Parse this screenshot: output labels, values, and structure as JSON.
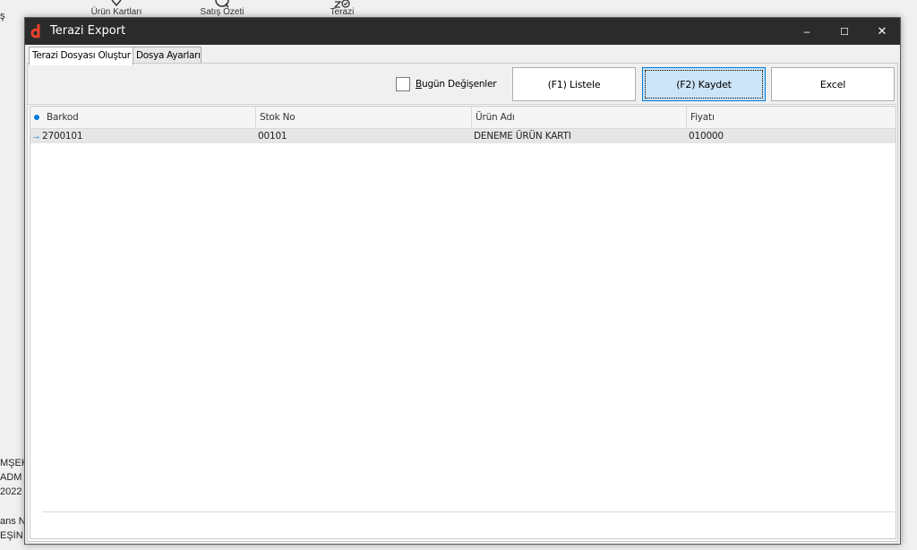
{
  "background": {
    "toolbar_items": [
      {
        "label": "Ürün Kartları",
        "icon": "tag-icon"
      },
      {
        "label": "Satış Özeti",
        "icon": "search-icon"
      },
      {
        "label": "Terazi",
        "icon": "scale-check-icon"
      }
    ],
    "left_fragments": [
      "ş",
      "MŞEK",
      "ADM",
      "2022",
      "ans N",
      "EŞİN -"
    ]
  },
  "window": {
    "title": "Terazi Export",
    "controls": {
      "minimize": "–",
      "maximize": "☐",
      "close": "✕"
    }
  },
  "tabs": [
    {
      "label": "Terazi Dosyası Oluştur",
      "active": true
    },
    {
      "label": "Dosya Ayarları",
      "active": false
    }
  ],
  "toolbar": {
    "checkbox": {
      "label_access": "B",
      "label_rest": "ugün Değişenler",
      "checked": false
    },
    "list_button": "(F1) Listele",
    "save_button": "(F2) Kaydet",
    "excel_button": "Excel"
  },
  "grid": {
    "columns": [
      "Barkod",
      "Stok No",
      "Ürün Adı",
      "Fiyatı"
    ],
    "rows": [
      {
        "barkod": "2700101",
        "stok_no": "00101",
        "urun_adi": "DENEME ÜRÜN KARTI",
        "fiyati": "010000"
      }
    ]
  },
  "colors": {
    "titlebar": "#2b2b2b",
    "accent": "#0078d7",
    "focused_button": "#cce4f7",
    "app_icon": "#e8412c"
  }
}
